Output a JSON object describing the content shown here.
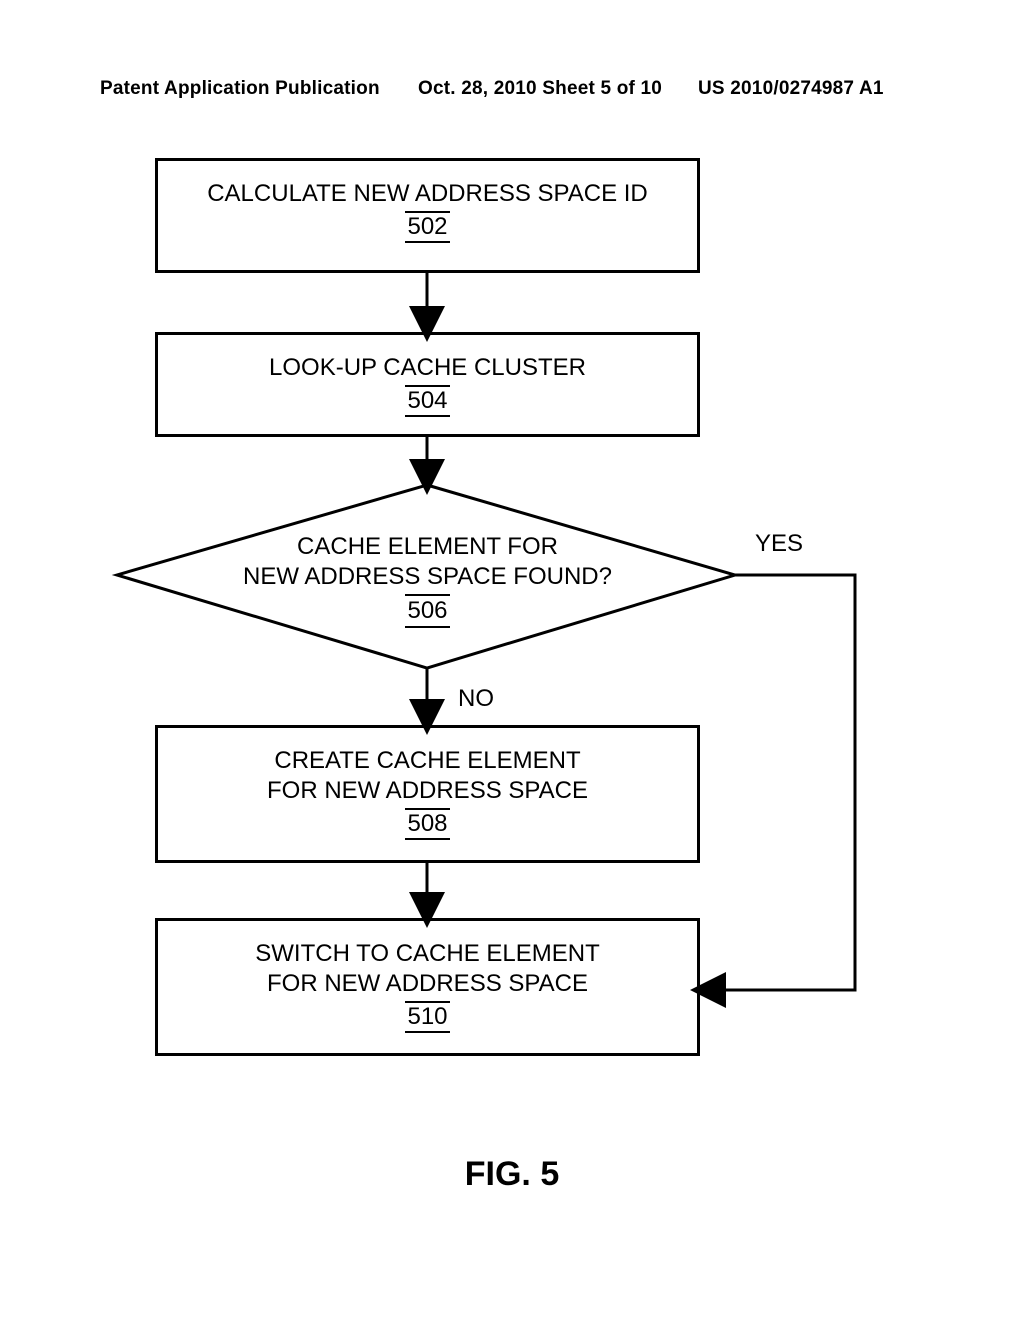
{
  "header": {
    "left": "Patent Application Publication",
    "mid": "Oct. 28, 2010  Sheet 5 of 10",
    "right": "US 2010/0274987 A1"
  },
  "figure_label": "FIG. 5",
  "boxes": {
    "b502": {
      "text": "CALCULATE NEW ADDRESS SPACE ID",
      "ref": "502"
    },
    "b504": {
      "text": "LOOK-UP CACHE CLUSTER",
      "ref": "504"
    },
    "b506": {
      "line1": "CACHE ELEMENT FOR",
      "line2": "NEW ADDRESS SPACE FOUND?",
      "ref": "506"
    },
    "b508": {
      "line1": "CREATE CACHE ELEMENT",
      "line2": "FOR NEW ADDRESS SPACE",
      "ref": "508"
    },
    "b510": {
      "line1": "SWITCH TO CACHE ELEMENT",
      "line2": "FOR NEW ADDRESS SPACE",
      "ref": "510"
    }
  },
  "labels": {
    "yes": "YES",
    "no": "NO"
  }
}
